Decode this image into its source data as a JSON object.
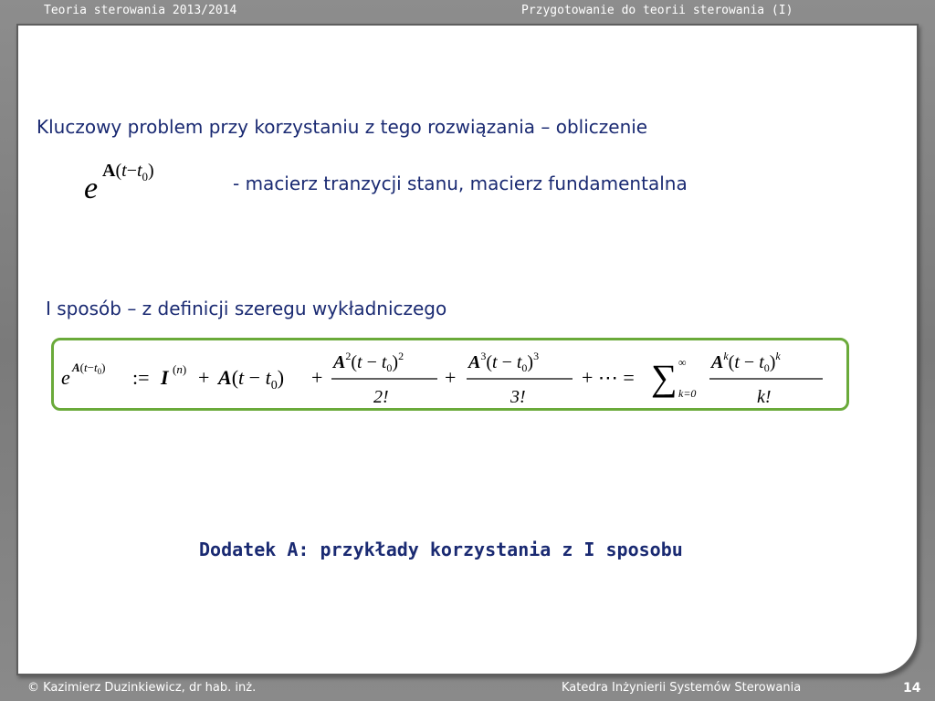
{
  "header": {
    "left_title": "Teoria sterowania 2013/2014",
    "right_title": "Przygotowanie do teorii sterowania (I)"
  },
  "content": {
    "line1": "Kluczowy problem przy korzystaniu z tego rozwiązania – obliczenie",
    "line2": "- macierz tranzycji stanu, macierz fundamentalna",
    "line3": "I sposób – z definicji szeregu wykładniczego",
    "appendix_link": "Dodatek A: przykłady korzystania z I sposobu"
  },
  "formula": {
    "exp_base": "e",
    "exp_power": "A(t−t₀)"
  },
  "footer": {
    "author": "© Kazimierz Duzinkiewicz, dr hab. inż.",
    "department": "Katedra Inżynierii Systemów Sterowania",
    "page_number": "14"
  },
  "colors": {
    "text_blue": "#1a2a72",
    "formula_border": "#6aaa3a",
    "frame_gray": "#7a7a7a"
  }
}
